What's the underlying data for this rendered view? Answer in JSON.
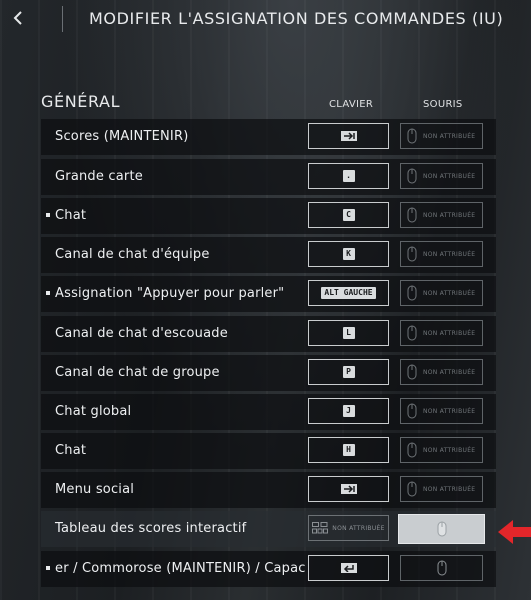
{
  "header": {
    "title": "MODIFIER L'ASSIGNATION DES COMMANDES (IU)"
  },
  "section": {
    "title": "GÉNÉRAL",
    "col_keyboard": "CLAVIER",
    "col_mouse": "SOURIS"
  },
  "rows": [
    {
      "label": "Scores (MAINTENIR)",
      "key": "",
      "key_icon": "tab-key-icon",
      "mouse": "NON ATTRIBUÉE",
      "marker": false
    },
    {
      "label": "Grande carte",
      "key": ".",
      "key_icon": "",
      "mouse": "NON ATTRIBUÉE",
      "marker": false
    },
    {
      "label": "Chat",
      "key": "C",
      "key_icon": "",
      "mouse": "NON ATTRIBUÉE",
      "marker": true
    },
    {
      "label": "Canal de chat d'équipe",
      "key": "K",
      "key_icon": "",
      "mouse": "NON ATTRIBUÉE",
      "marker": false
    },
    {
      "label": "Assignation \"Appuyer pour parler\"",
      "key": "ALT GAUCHE",
      "key_icon": "",
      "mouse": "NON ATTRIBUÉE",
      "marker": true
    },
    {
      "label": "Canal de chat d'escouade",
      "key": "L",
      "key_icon": "",
      "mouse": "NON ATTRIBUÉE",
      "marker": false
    },
    {
      "label": "Canal de chat de groupe",
      "key": "P",
      "key_icon": "",
      "mouse": "NON ATTRIBUÉE",
      "marker": false
    },
    {
      "label": "Chat global",
      "key": "J",
      "key_icon": "",
      "mouse": "NON ATTRIBUÉE",
      "marker": false
    },
    {
      "label": "Chat",
      "key": "H",
      "key_icon": "",
      "mouse": "NON ATTRIBUÉE",
      "marker": false
    },
    {
      "label": "Menu social",
      "key": "",
      "key_icon": "tab-key-icon",
      "mouse": "NON ATTRIBUÉE",
      "marker": false
    },
    {
      "label": "Tableau des scores interactif",
      "key": "NON ATTRIBUÉE",
      "key_icon": "keyboard-icon",
      "mouse": "",
      "marker": false
    },
    {
      "label": "er / Commorose (MAINTENIR) / Capac",
      "key": "",
      "key_icon": "enter-key-icon",
      "mouse": "",
      "marker": true
    }
  ],
  "colors": {
    "accent_arrow": "#e3262a",
    "row_bg": "#0c0e10",
    "active_mouse_bg": "#c9cdd0"
  }
}
